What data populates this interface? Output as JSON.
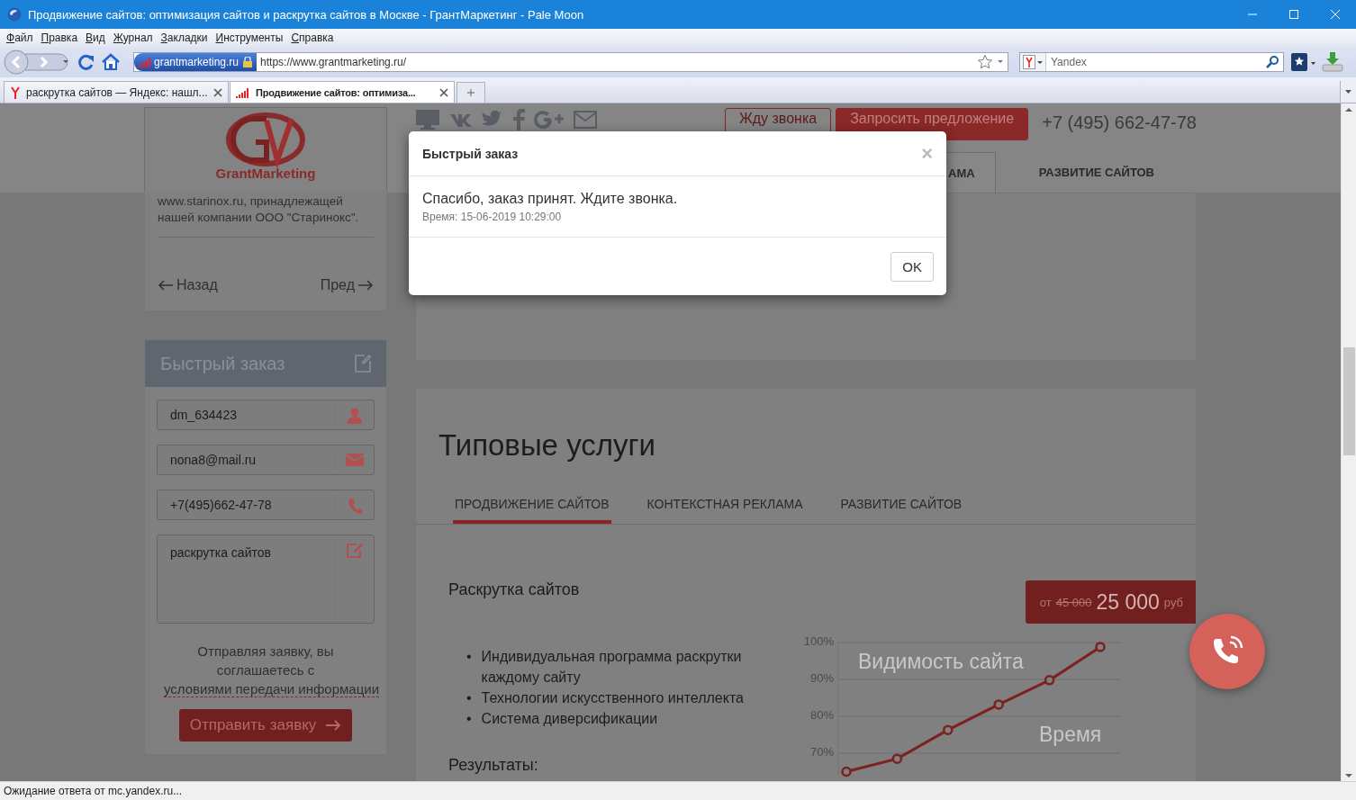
{
  "window": {
    "title": "Продвижение сайтов: оптимизация сайтов и раскрутка сайтов в Москве - ГрантМаркетинг - Pale Moon"
  },
  "menu": [
    "Файл",
    "Правка",
    "Вид",
    "Журнал",
    "Закладки",
    "Инструменты",
    "Справка"
  ],
  "toolbar": {
    "identity": "grantmarketing.ru",
    "url": "https://www.grantmarketing.ru/",
    "search": {
      "placeholder": "Yandex"
    }
  },
  "tabs": [
    {
      "label": "раскрутка сайтов — Яндекс: нашл...",
      "kind": "search",
      "selected": false
    },
    {
      "label": "Продвижение сайтов: оптимиза...",
      "kind": "site",
      "selected": true
    }
  ],
  "page": {
    "sidebar": {
      "logo_text": "GrantMarketing",
      "about": "www.starinox.ru, принадлежащей нашей компании ООО \"Старинокс\".",
      "pager": {
        "back": "Назад",
        "next": "Пред"
      },
      "quick_order": {
        "title": "Быстрый заказ",
        "fields": [
          {
            "kind": "name",
            "value": "dm_634423"
          },
          {
            "kind": "email",
            "value": "nona8@mail.ru"
          },
          {
            "kind": "phone",
            "value": "+7(495)662-47-78"
          },
          {
            "kind": "message",
            "value": "раскрутка сайтов"
          }
        ],
        "consent": {
          "text": "Отправляя заявку, вы соглашаетесь с",
          "link": "условиями передачи информации"
        },
        "submit": "Отправить заявку"
      }
    },
    "header": {
      "buttons": [
        {
          "label": "Жду звонка",
          "kind": "outline"
        },
        {
          "label": "Запросить предложение",
          "kind": "filled"
        }
      ],
      "phone": "+7 (495) 662-47-78",
      "nav": [
        {
          "label": "АМА",
          "selected": true
        },
        {
          "label": "РАЗВИТИЕ САЙТОВ",
          "selected": false
        }
      ]
    },
    "services": {
      "title": "Типовые услуги",
      "tabs": [
        {
          "label": "ПРОДВИЖЕНИЕ САЙТОВ",
          "selected": true
        },
        {
          "label": "КОНТЕКСТНАЯ РЕКЛАМА",
          "selected": false
        },
        {
          "label": "РАЗВИТИЕ САЙТОВ",
          "selected": false
        }
      ],
      "item": {
        "title": "Раскрутка сайтов",
        "price": {
          "prefix": "от",
          "old": "45 000",
          "value": "25 000",
          "currency": "руб"
        },
        "bullet": "•",
        "features": [
          "Индивидуальная программа раскрутки каждому сайту",
          "Технологии искусственного интеллекта",
          "Система диверсификации"
        ],
        "results_label": "Результаты:",
        "chart_data": {
          "type": "line",
          "xlabel": "Время",
          "ylabel": "Видимость сайта",
          "grid": true,
          "ylim": [
            64,
            100
          ],
          "yticks": [
            {
              "value": 70,
              "label": "70%"
            },
            {
              "value": 80,
              "label": "80%"
            },
            {
              "value": 90,
              "label": "90%"
            },
            {
              "value": 100,
              "label": "100%"
            }
          ],
          "series": [
            {
              "color": "#7d2020",
              "marker": true,
              "values": [
                65,
                68.5,
                76.3,
                83.2,
                89.8,
                98.8
              ]
            }
          ]
        }
      }
    }
  },
  "modal": {
    "title": "Быстрый заказ",
    "close": "×",
    "message": "Спасибо, заказ принят. Ждите звонка.",
    "time": "Время: 15-06-2019 10:29:00",
    "button": "OK"
  },
  "status_bar": "Ожидание ответа от mc.yandex.ru..."
}
